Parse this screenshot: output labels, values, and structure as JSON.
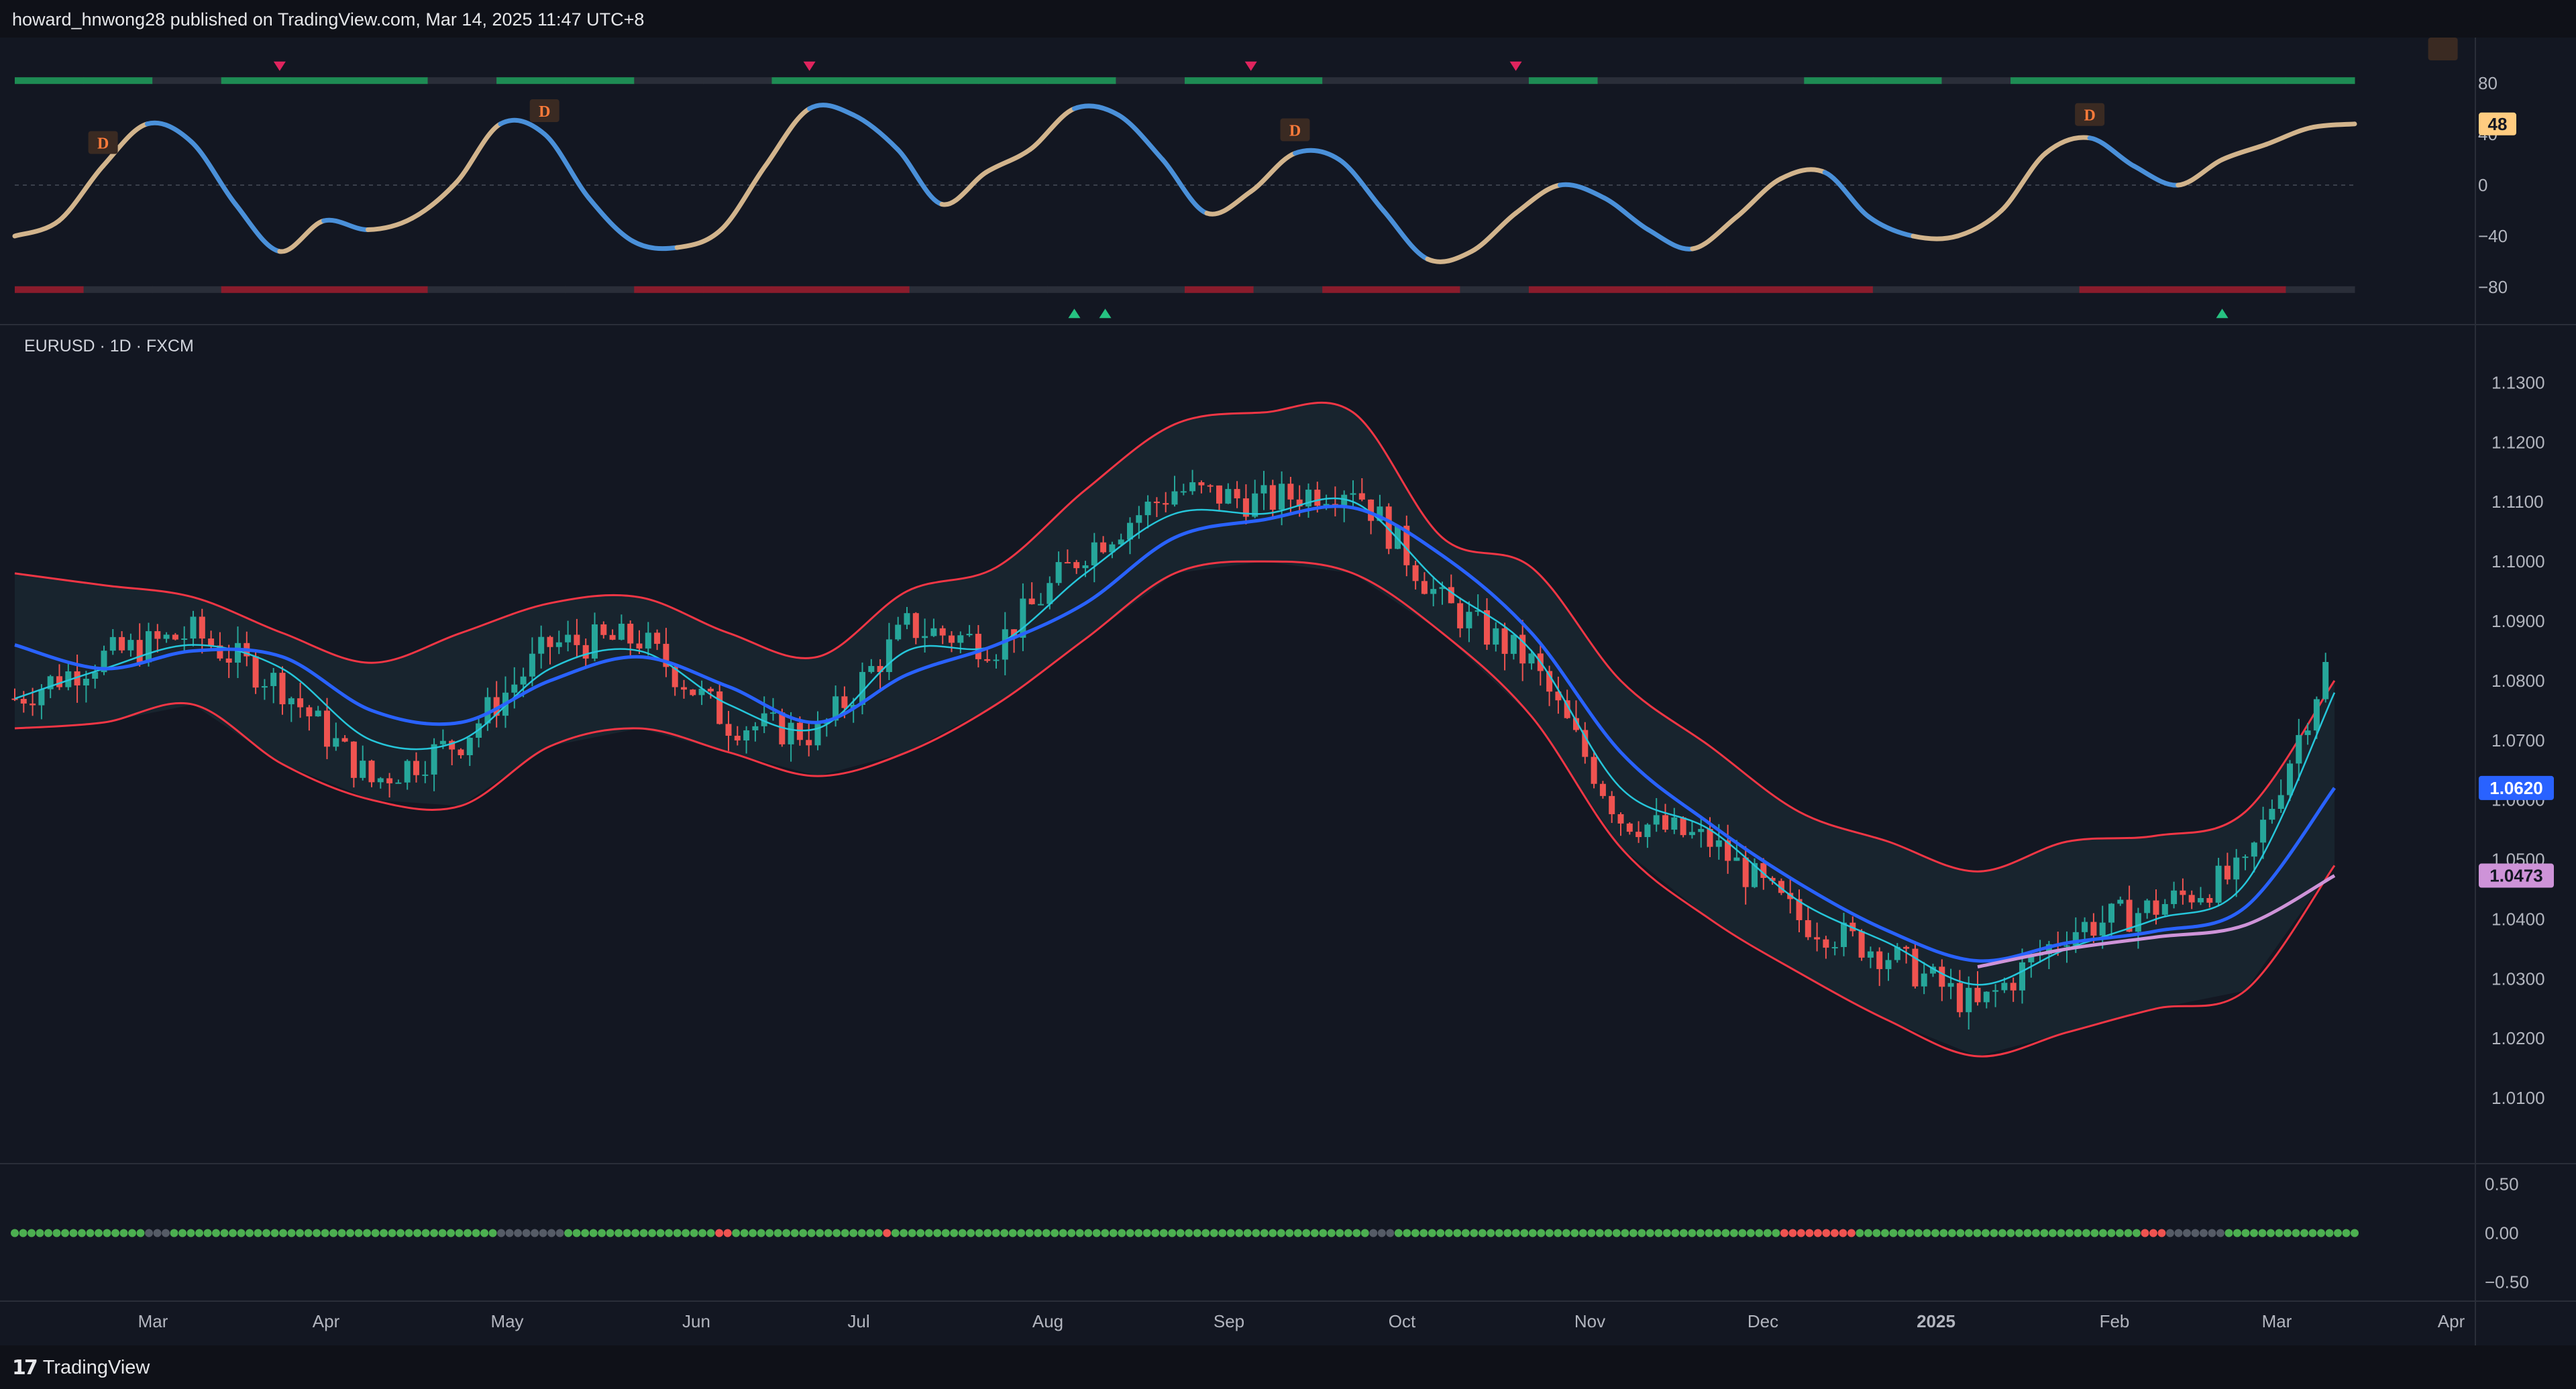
{
  "header": {
    "published_text": "howard_hnwong28 published on TradingView.com, Mar 14, 2025 11:47 UTC+8"
  },
  "footer": {
    "brand": "TradingView",
    "logo_glyph": "𝟭𝟳"
  },
  "colors": {
    "bg": "#131722",
    "bull": "#26a69a",
    "bear": "#ef5350",
    "band": "#f23645",
    "ema_fast": "#26c6da",
    "ema_mid": "#2962ff",
    "ema_slow": "#ce93d8",
    "osc_up": "#d2b48c",
    "osc_down": "#4a90d9",
    "price_tag": "#2962ff",
    "slow_tag": "#ce93d8",
    "osc_tag": "#ffcc80"
  },
  "chart_data": [
    {
      "type": "line",
      "title": "",
      "ylim": [
        -100,
        100
      ],
      "yticks": [
        "80",
        "40",
        "0",
        "−40",
        "−80"
      ],
      "ytick_values": [
        80,
        40,
        0,
        -40,
        -80
      ],
      "current_value_tag": "48",
      "divergence_label": "D",
      "x_months": [
        "Mar",
        "Apr",
        "May",
        "Jun",
        "Jul",
        "Aug",
        "Sep",
        "Oct",
        "Nov",
        "Dec",
        "2025",
        "Feb",
        "Mar",
        "Apr"
      ],
      "series": [
        {
          "values": [
            -40,
            -28,
            15,
            48,
            34,
            -15,
            -52,
            -28,
            -35,
            -26,
            2,
            48,
            40,
            -10,
            -44,
            -49,
            -35,
            15,
            60,
            55,
            28,
            -15,
            10,
            28,
            60,
            55,
            20,
            -22,
            -5,
            25,
            20,
            -20,
            -58,
            -52,
            -22,
            0,
            -10,
            -35,
            -50,
            -25,
            5,
            10,
            -25,
            -40,
            -40,
            -20,
            25,
            37,
            15,
            0,
            20,
            32,
            45,
            48
          ]
        }
      ],
      "divergence_x_index": [
        2,
        12,
        29,
        47,
        55
      ],
      "sell_signals_x": [
        6,
        18,
        28,
        34
      ],
      "buy_signals_x": [
        24,
        24.7,
        50
      ]
    },
    {
      "type": "candlestick",
      "title": "",
      "symbol_label": "EURUSD · 1D · FXCM",
      "ylim": [
        1.0,
        1.135
      ],
      "yticks": [
        "1.1300",
        "1.1200",
        "1.1100",
        "1.1000",
        "1.0900",
        "1.0800",
        "1.0700",
        "1.0600",
        "1.0500",
        "1.0400",
        "1.0300",
        "1.0200",
        "1.0100"
      ],
      "ytick_values": [
        1.13,
        1.12,
        1.11,
        1.1,
        1.09,
        1.08,
        1.07,
        1.06,
        1.05,
        1.04,
        1.03,
        1.02,
        1.01
      ],
      "price_tag": "1.0620",
      "slow_ma_tag": "1.0473",
      "x": [
        "Feb 12",
        "Mar 1",
        "Mar 15",
        "Apr 1",
        "Apr 15",
        "May 1",
        "May 15",
        "Jun 1",
        "Jun 15",
        "Jul 1",
        "Jul 15",
        "Aug 1",
        "Aug 15",
        "Sep 1",
        "Sep 15",
        "Oct 1",
        "Oct 15",
        "Nov 1",
        "Nov 15",
        "Dec 1",
        "Dec 15",
        "Jan 1",
        "Jan 15",
        "Feb 1",
        "Feb 15",
        "Mar 1",
        "Mar 14"
      ],
      "close": [
        1.077,
        1.084,
        1.088,
        1.079,
        1.063,
        1.07,
        1.086,
        1.087,
        1.073,
        1.071,
        1.089,
        1.086,
        1.102,
        1.112,
        1.11,
        1.113,
        1.093,
        1.083,
        1.057,
        1.053,
        1.04,
        1.034,
        1.025,
        1.038,
        1.042,
        1.048,
        1.086
      ],
      "ema_fast": [
        1.077,
        1.082,
        1.086,
        1.082,
        1.07,
        1.07,
        1.082,
        1.085,
        1.076,
        1.072,
        1.085,
        1.086,
        1.098,
        1.108,
        1.108,
        1.11,
        1.096,
        1.085,
        1.062,
        1.055,
        1.043,
        1.036,
        1.029,
        1.035,
        1.04,
        1.046,
        1.078
      ],
      "ema_mid": [
        1.086,
        1.082,
        1.085,
        1.084,
        1.075,
        1.073,
        1.08,
        1.084,
        1.079,
        1.073,
        1.081,
        1.086,
        1.093,
        1.104,
        1.107,
        1.109,
        1.101,
        1.088,
        1.068,
        1.056,
        1.046,
        1.038,
        1.033,
        1.036,
        1.038,
        1.042,
        1.062
      ],
      "ema_slow": [
        null,
        null,
        null,
        null,
        null,
        null,
        null,
        null,
        null,
        null,
        null,
        null,
        null,
        null,
        null,
        null,
        null,
        null,
        null,
        null,
        null,
        null,
        1.032,
        1.035,
        1.037,
        1.039,
        1.0473
      ],
      "band_upper": [
        1.098,
        1.096,
        1.094,
        1.088,
        1.083,
        1.088,
        1.093,
        1.094,
        1.088,
        1.084,
        1.095,
        1.099,
        1.112,
        1.123,
        1.125,
        1.125,
        1.104,
        1.099,
        1.08,
        1.069,
        1.058,
        1.053,
        1.048,
        1.053,
        1.054,
        1.058,
        1.08
      ],
      "band_lower": [
        1.072,
        1.073,
        1.076,
        1.066,
        1.06,
        1.059,
        1.069,
        1.072,
        1.068,
        1.064,
        1.068,
        1.076,
        1.087,
        1.098,
        1.1,
        1.098,
        1.088,
        1.074,
        1.052,
        1.04,
        1.031,
        1.023,
        1.017,
        1.021,
        1.025,
        1.028,
        1.049
      ]
    },
    {
      "type": "scatter",
      "title": "",
      "ylim": [
        -0.6,
        0.6
      ],
      "yticks": [
        "0.50",
        "0.00",
        "−0.50"
      ],
      "ytick_values": [
        0.5,
        0.0,
        -0.5
      ],
      "dot_value": 0.0,
      "segments": [
        {
          "from": 0,
          "to": 0.055,
          "color": "#4caf50"
        },
        {
          "from": 0.055,
          "to": 0.065,
          "color": "#555b66"
        },
        {
          "from": 0.065,
          "to": 0.205,
          "color": "#4caf50"
        },
        {
          "from": 0.205,
          "to": 0.235,
          "color": "#555b66"
        },
        {
          "from": 0.235,
          "to": 0.3,
          "color": "#4caf50"
        },
        {
          "from": 0.3,
          "to": 0.305,
          "color": "#ef5350"
        },
        {
          "from": 0.305,
          "to": 0.37,
          "color": "#4caf50"
        },
        {
          "from": 0.37,
          "to": 0.375,
          "color": "#ef5350"
        },
        {
          "from": 0.375,
          "to": 0.58,
          "color": "#4caf50"
        },
        {
          "from": 0.58,
          "to": 0.59,
          "color": "#555b66"
        },
        {
          "from": 0.59,
          "to": 0.755,
          "color": "#4caf50"
        },
        {
          "from": 0.755,
          "to": 0.785,
          "color": "#ef5350"
        },
        {
          "from": 0.785,
          "to": 0.91,
          "color": "#4caf50"
        },
        {
          "from": 0.91,
          "to": 0.92,
          "color": "#ef5350"
        },
        {
          "from": 0.92,
          "to": 0.945,
          "color": "#555b66"
        },
        {
          "from": 0.945,
          "to": 1.0,
          "color": "#4caf50"
        }
      ]
    }
  ]
}
